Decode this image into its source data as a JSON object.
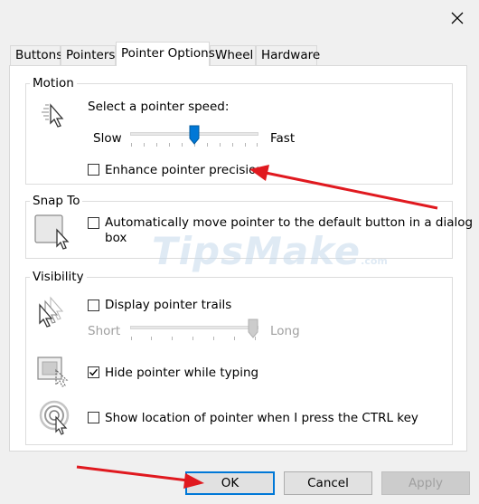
{
  "tabs": [
    {
      "label": "Buttons"
    },
    {
      "label": "Pointers"
    },
    {
      "label": "Pointer Options"
    },
    {
      "label": "Wheel"
    },
    {
      "label": "Hardware"
    }
  ],
  "active_tab": "Pointer Options",
  "motion": {
    "title": "Motion",
    "speed_label": "Select a pointer speed:",
    "slow": "Slow",
    "fast": "Fast",
    "speed_level": 0.5,
    "enhance_label": "Enhance pointer precision",
    "enhance_checked": false
  },
  "snap": {
    "title": "Snap To",
    "auto_label_line1": "Automatically move pointer to the default button in a dialog",
    "auto_label_line2": "box",
    "auto_checked": false
  },
  "visibility": {
    "title": "Visibility",
    "trails_label": "Display pointer trails",
    "trails_checked": false,
    "short": "Short",
    "long": "Long",
    "trail_level": 1.0,
    "hide_label": "Hide pointer while typing",
    "hide_checked": true,
    "ctrl_label": "Show location of pointer when I press the CTRL key",
    "ctrl_checked": false
  },
  "watermark": {
    "main": "TipsMake",
    "suffix": ".com"
  },
  "buttons": {
    "ok": "OK",
    "cancel": "Cancel",
    "apply": "Apply"
  },
  "colors": {
    "accent": "#0078d7",
    "annotation_arrow": "#e0191f"
  },
  "icons": {
    "close": "close-icon",
    "motion": "pointer-speed-icon",
    "snap": "snap-to-icon",
    "trails": "pointer-trails-icon",
    "hide": "hide-pointer-icon",
    "ctrl": "ctrl-locate-icon",
    "check": "checkmark-icon"
  }
}
